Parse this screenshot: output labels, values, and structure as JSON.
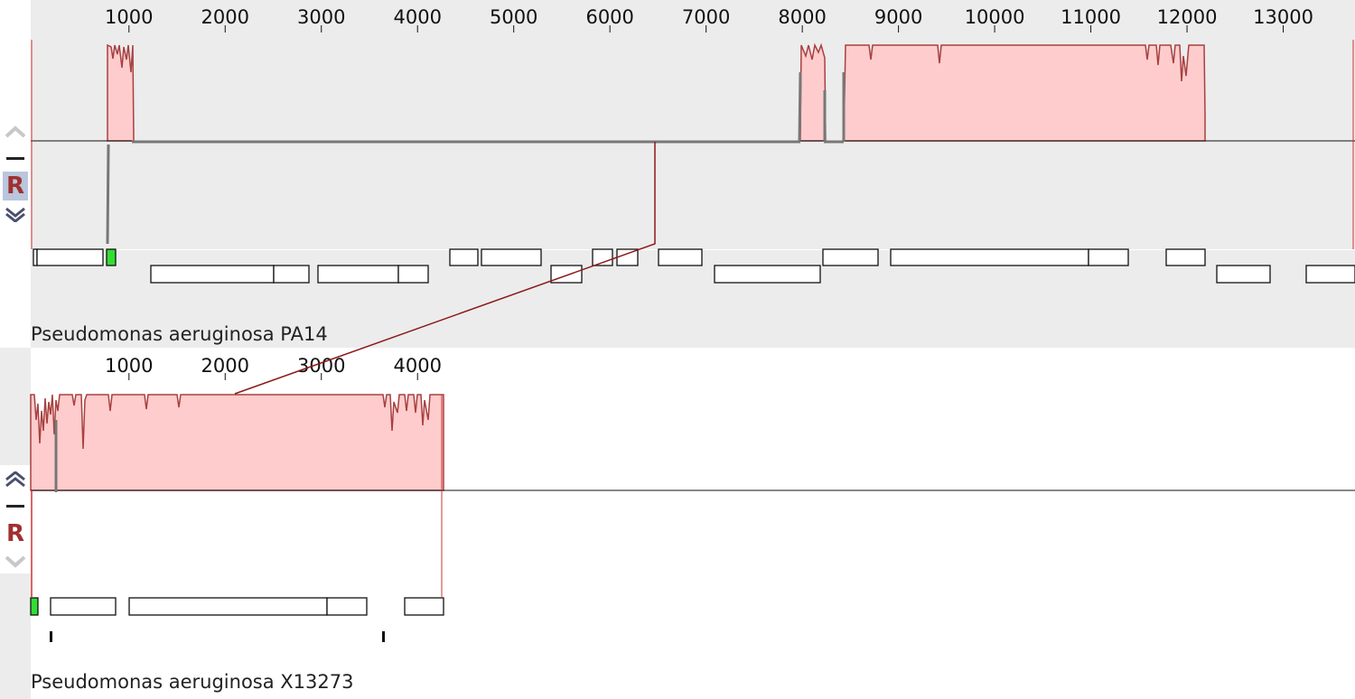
{
  "colors": {
    "selected_panel_bg": "#ececec",
    "panel_bg": "#ffffff",
    "lcb_fill": "#fecccc",
    "lcb_line": "#a84040",
    "connector": "#8b1a1a",
    "rna_gene": "#33dd33",
    "gap": "#777777"
  },
  "genomes": [
    {
      "name": "Pseudomonas aeruginosa PA14",
      "selected": true,
      "ruler": {
        "min": 0,
        "max": 13770,
        "ticks": [
          "1000",
          "2000",
          "3000",
          "4000",
          "5000",
          "6000",
          "7000",
          "8000",
          "9000",
          "10000",
          "11000",
          "12000",
          "13000"
        ]
      },
      "controls": {
        "up_icon": "chevron-up-icon",
        "minus_icon": "minus-icon",
        "r_label": "R",
        "down_icon": "chevron-down-icon"
      }
    },
    {
      "name": "Pseudomonas aeruginosa X13273",
      "selected": false,
      "ruler": {
        "min": 0,
        "max": 4300,
        "ticks": [
          "1000",
          "2000",
          "3000",
          "4000"
        ]
      },
      "controls": {
        "up_icon": "chevron-up-icon",
        "minus_icon": "minus-icon",
        "r_label": "R",
        "down_icon": "chevron-down-icon"
      }
    }
  ]
}
